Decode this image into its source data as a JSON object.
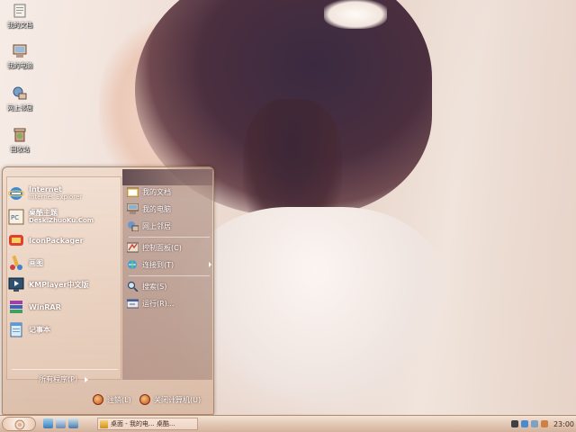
{
  "desktop": {
    "icons": [
      {
        "label": "我的文档"
      },
      {
        "label": "我的电脑"
      },
      {
        "label": "网上邻居"
      },
      {
        "label": "回收站"
      }
    ]
  },
  "start_menu": {
    "programs": [
      {
        "title": "Internet",
        "subtitle": "Internet Explorer",
        "icon": "ie-icon"
      },
      {
        "title": "桌酷主题",
        "subtitle": "Desk.ZhuoKu.Com",
        "icon": "zhuoku-icon"
      },
      {
        "title": "IconPackager",
        "subtitle": "",
        "icon": "iconpackager-icon"
      },
      {
        "title": "画图",
        "subtitle": "",
        "icon": "paint-icon"
      },
      {
        "title": "KMPlayer中文版",
        "subtitle": "",
        "icon": "kmplayer-icon"
      },
      {
        "title": "WinRAR",
        "subtitle": "",
        "icon": "winrar-icon"
      },
      {
        "title": "记事本",
        "subtitle": "",
        "icon": "notepad-icon"
      }
    ],
    "all_programs": "所有程序(P)",
    "places": [
      {
        "label": "我的文档",
        "icon": "folder-icon"
      },
      {
        "label": "我的电脑",
        "icon": "computer-icon"
      },
      {
        "label": "网上邻居",
        "icon": "network-icon"
      },
      {
        "label": "控制面板(C)",
        "icon": "control-panel-icon"
      },
      {
        "label": "连接到(T)",
        "icon": "connect-icon"
      },
      {
        "label": "搜索(S)",
        "icon": "search-icon"
      },
      {
        "label": "运行(R)...",
        "icon": "run-icon"
      }
    ],
    "logoff": "注销(L)",
    "shutdown": "关闭计算机(U)"
  },
  "taskbar": {
    "task_label": "桌面 - 我的电...  桌酷...",
    "clock": "23:00"
  },
  "colors": {
    "accent": "#c05010",
    "taskbar": "#e3c8b5"
  }
}
